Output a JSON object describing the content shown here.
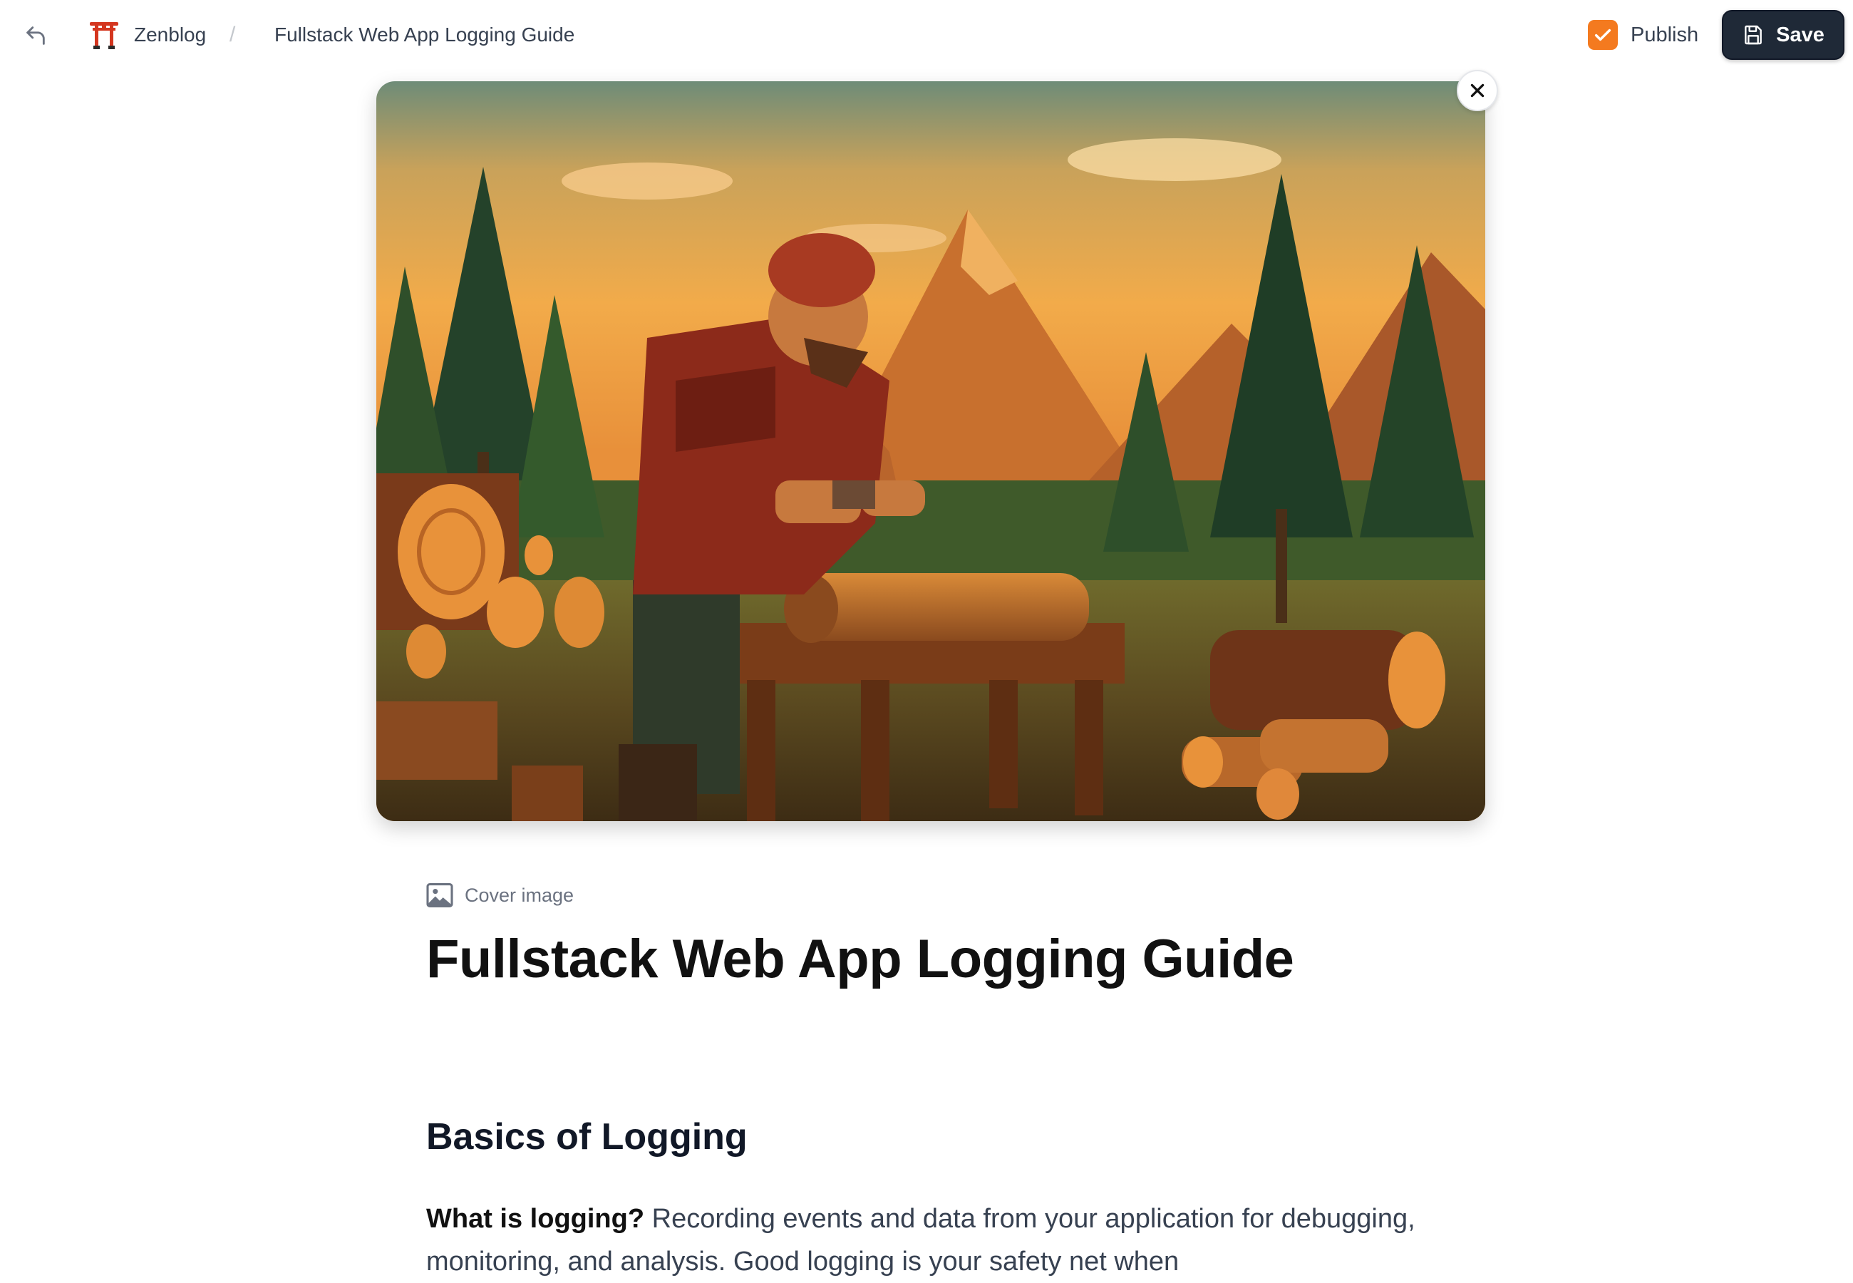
{
  "header": {
    "brand": "Zenblog",
    "separator": "/",
    "breadcrumb_title": "Fullstack Web App Logging Guide",
    "publish_label": "Publish",
    "publish_checked": true,
    "save_label": "Save"
  },
  "cover": {
    "description_label": "Cover image",
    "close_icon": "close-icon"
  },
  "post": {
    "title": "Fullstack Web App Logging Guide",
    "section_heading": "Basics of Logging",
    "paragraph_lead": "What is logging?",
    "paragraph_body": "Recording events and data from your application for debugging, monitoring, and analysis. Good logging is your safety net when"
  },
  "colors": {
    "accent": "#f47a1f",
    "save_bg": "#1f2937",
    "logo": "#d4361f"
  }
}
